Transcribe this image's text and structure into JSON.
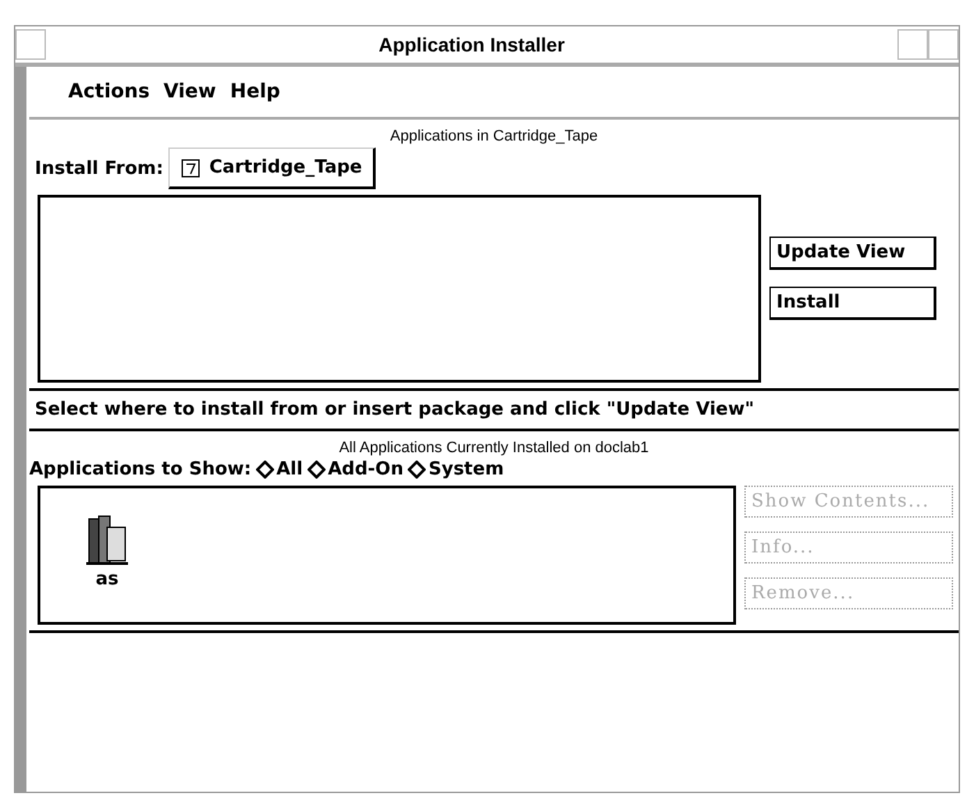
{
  "window": {
    "title": "Application Installer"
  },
  "menu": [
    "Actions",
    "View",
    "Help"
  ],
  "source_section": {
    "heading": "Applications in Cartridge_Tape",
    "install_from_label": "Install From:",
    "source": "Cartridge_Tape",
    "buttons": [
      {
        "label": "Update View",
        "disabled": false
      },
      {
        "label": "Install",
        "disabled": false
      }
    ]
  },
  "message": "Select where to install from or insert package and click \"Update View\"",
  "installed_section": {
    "heading": "All Applications Currently Installed on doclab1",
    "show_label": "Applications to Show:",
    "filters": [
      {
        "label": "All",
        "selected": false
      },
      {
        "label": "Add-On",
        "selected": false
      },
      {
        "label": "System",
        "selected": false
      }
    ],
    "applications": [
      {
        "name": "as"
      }
    ],
    "buttons": [
      {
        "label": "Show Contents...",
        "disabled": true
      },
      {
        "label": "Info...",
        "disabled": true
      },
      {
        "label": "Remove...",
        "disabled": true
      }
    ]
  }
}
